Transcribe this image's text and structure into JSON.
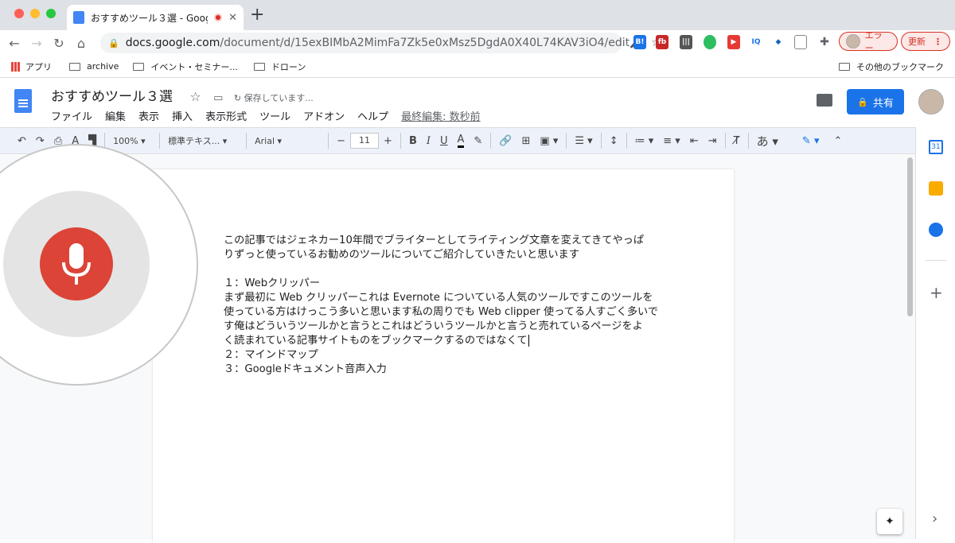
{
  "browser": {
    "tab_title": "おすすめツール３選 - Google",
    "new_tab": "+",
    "url_host": "docs.google.com",
    "url_path": "/document/d/15exBIMbA2MimFa7Zk5e0xMsz5DgdA0X40L74KAV3iO4/edit",
    "error_label": "エラー",
    "update_label": "更新",
    "more_icon": "⋮"
  },
  "bookmarks": {
    "apps": "アプリ",
    "items": [
      "archive",
      "イベント・セミナー...",
      "ドローン"
    ],
    "other": "その他のブックマーク"
  },
  "docs": {
    "title": "おすすめツール３選",
    "saving": "保存しています...",
    "menu": [
      "ファイル",
      "編集",
      "表示",
      "挿入",
      "表示形式",
      "ツール",
      "アドオン",
      "ヘルプ"
    ],
    "last_edit": "最終編集: 数秒前",
    "share": "共有"
  },
  "format_bar": {
    "zoom": "100%",
    "style": "標準テキス...",
    "font": "Arial",
    "size": "11",
    "minus": "−",
    "plus": "+",
    "bold": "B",
    "italic": "I",
    "underline": "U",
    "color": "A",
    "input_mode": "あ"
  },
  "document": {
    "lines": [
      "この記事ではジェネカー10年間でブライターとしてライティング文章を変えてきてやっぱ",
      "りずっと使っているお勧めのツールについてご紹介していきたいと思います",
      "",
      "１：Webクリッパー",
      "まず最初に Web クリッパーこれは Evernote についている人気のツールですこのツールを",
      "使っている方はけっこう多いと思います私の周りでも Web clipper 使ってる人すごく多いで",
      "す俺はどういうツールかと言うとこれはどういうツールかと言うと売れているページをよ",
      "く読まれている記事サイトものをブックマークするのではなくて",
      "２：マインドマップ",
      "３：Googleドキュメント音声入力"
    ]
  },
  "sidepanel": {
    "calendar_day": "31",
    "add": "+",
    "chevron": "›"
  },
  "colors": {
    "accent": "#1a73e8",
    "mic": "#db4437"
  }
}
